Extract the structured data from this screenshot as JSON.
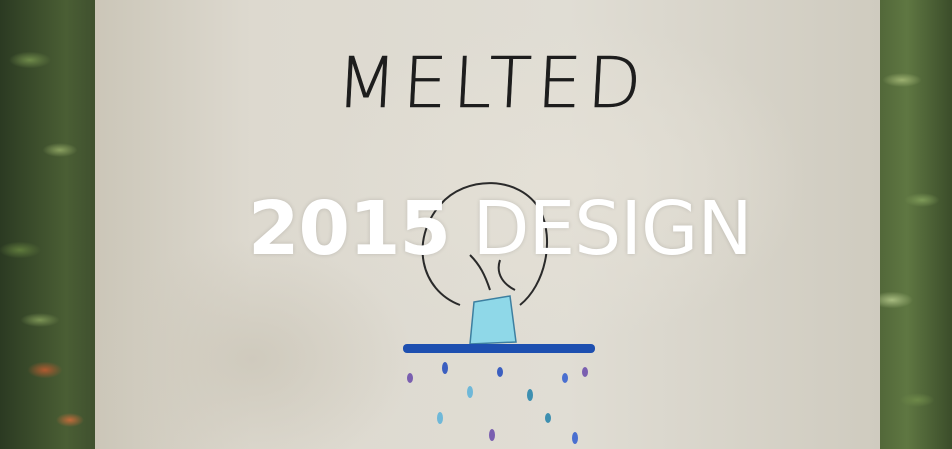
{
  "photo": {
    "bag_text": "MELTED"
  },
  "overlay": {
    "year": "2015",
    "label": "DESIGN"
  },
  "colors": {
    "overlay_text": "#ffffff",
    "ice_blue": "#7fd0e0",
    "puddle_blue": "#1d4fb0"
  }
}
